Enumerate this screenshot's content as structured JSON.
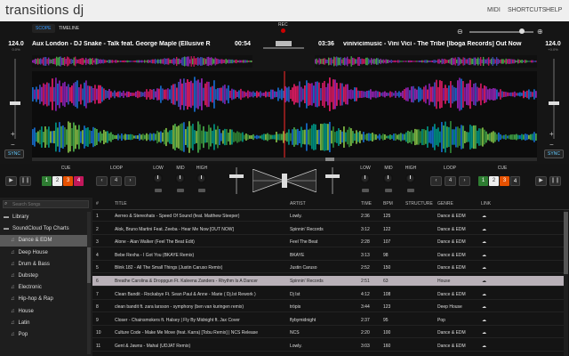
{
  "app_title": "transitions dj",
  "nav": {
    "midi": "MIDI",
    "shortcuts": "SHORTCUTS",
    "help": "HELP"
  },
  "tabs": {
    "scope": "SCOPE",
    "timeline": "TIMELINE"
  },
  "rec": "REC",
  "deck_left": {
    "track": "Aux London - DJ Snake - Talk feat. George Maple (Ellusive R",
    "time": "00:54",
    "bpm": "124.0",
    "bpm_sub": "0.0%",
    "sync": "SYNC"
  },
  "deck_right": {
    "track": "vinivicimusic - Vini Vici - The Tribe [Iboga Records] Out Now",
    "time": "03:36",
    "bpm": "124.0",
    "bpm_sub": "+0.0%",
    "sync": "SYNC"
  },
  "controls": {
    "cue": "CUE",
    "loop": "LOOP",
    "low": "LOW",
    "mid": "MID",
    "high": "HIGH",
    "loop_val": "4",
    "cue_nums": [
      "1",
      "2",
      "3",
      "4"
    ]
  },
  "colors": {
    "cue1": "#2e7d32",
    "cue2": "#eeeeee",
    "cue3": "#e65100",
    "cue4": "#c2185b",
    "accent": "#3399ff"
  },
  "search_placeholder": "Search Songs",
  "sidebar": {
    "items": [
      {
        "label": "Library",
        "icon": "folder-icon"
      },
      {
        "label": "SoundCloud Top Charts",
        "icon": "folder-icon"
      },
      {
        "label": "Dance & EDM",
        "icon": "playlist-icon",
        "selected": true
      },
      {
        "label": "Deep House",
        "icon": "playlist-icon"
      },
      {
        "label": "Drum & Bass",
        "icon": "playlist-icon"
      },
      {
        "label": "Dubstep",
        "icon": "playlist-icon"
      },
      {
        "label": "Electronic",
        "icon": "playlist-icon"
      },
      {
        "label": "Hip-hop & Rap",
        "icon": "playlist-icon"
      },
      {
        "label": "House",
        "icon": "playlist-icon"
      },
      {
        "label": "Latin",
        "icon": "playlist-icon"
      },
      {
        "label": "Pop",
        "icon": "playlist-icon"
      }
    ]
  },
  "table": {
    "headers": [
      "#",
      "TITLE",
      "ARTIST",
      "TIME",
      "BPM",
      "STRUCTURE",
      "GENRE",
      "LINK"
    ],
    "rows": [
      [
        "1",
        "Aerreo & Stereohats - Speed Of Sound (feat. Matthew Steeper)",
        "Lowly.",
        "2:36",
        "125",
        "",
        "Dance & EDM"
      ],
      [
        "2",
        "Alok, Bruno Martini Feat. Zeeba - Hear Me Now [OUT NOW]",
        "Spinnin' Records",
        "3:12",
        "122",
        "",
        "Dance & EDM"
      ],
      [
        "3",
        "Alone - Alan Walker (Feel The Beat Edit)",
        "Feel The Beat",
        "2:28",
        "107",
        "",
        "Dance & EDM"
      ],
      [
        "4",
        "Bebe Rexha - I Got You (BKAYE Remix)",
        "BKAYE",
        "3:13",
        "98",
        "",
        "Dance & EDM"
      ],
      [
        "5",
        "Blink 182 - All The Small Things (Justin Caruso Remix)",
        "Justin Caruso",
        "2:52",
        "150",
        "",
        "Dance & EDM"
      ],
      [
        "6",
        "Breathe Carolina & Droppgun Ft. Kaleena Zanders - Rhythm Is A Dancer",
        "Spinnin' Records",
        "2:51",
        "63",
        "",
        "House"
      ],
      [
        "7",
        "Clean Bandit - Rockabye Ft. Sean Paul & Anne - Marie ( Dj.Ist Rework )",
        "Dj Ist",
        "4:12",
        "108",
        "",
        "Dance & EDM"
      ],
      [
        "8",
        "clean bandit ft. zara larsson - symphony (ben van kuringen remix)",
        "tröpis",
        "3:44",
        "123",
        "",
        "Deep House"
      ],
      [
        "9",
        "Closer - Chainsmokers ft. Halsey | Fly By Midnight ft. Jax Cover",
        "flybymidnight",
        "2:37",
        "95",
        "",
        "Pop"
      ],
      [
        "10",
        "Culture Code - Make Me Move (feat. Karra) [Tobu Remix] | NCS Release",
        "NCS",
        "2:20",
        "100",
        "",
        "Dance & EDM"
      ],
      [
        "11",
        "Gent & Jawns - Mahal (UDJAT Remix)",
        "Lowly.",
        "3:03",
        "160",
        "",
        "Dance & EDM"
      ]
    ]
  }
}
